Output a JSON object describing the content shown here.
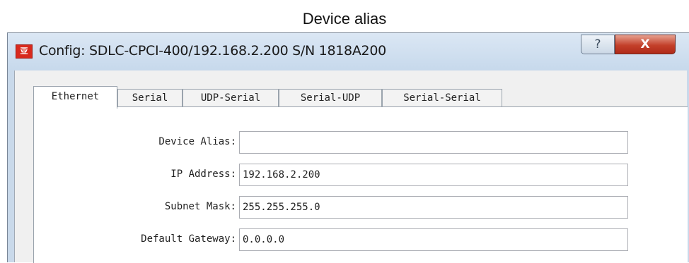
{
  "caption": "Device alias",
  "window": {
    "title": "Config: SDLC-CPCI-400/192.168.2.200 S/N 1818A200",
    "app_icon_glyph": "亚",
    "help_glyph": "?",
    "close_glyph": "X"
  },
  "tabs": [
    {
      "label": "Ethernet",
      "active": true
    },
    {
      "label": "Serial",
      "active": false
    },
    {
      "label": "UDP-Serial",
      "active": false
    },
    {
      "label": "Serial-UDP",
      "active": false
    },
    {
      "label": "Serial-Serial",
      "active": false
    }
  ],
  "fields": [
    {
      "label": "Device Alias:",
      "value": ""
    },
    {
      "label": "IP Address:",
      "value": "192.168.2.200"
    },
    {
      "label": "Subnet Mask:",
      "value": "255.255.255.0"
    },
    {
      "label": "Default Gateway:",
      "value": "0.0.0.0"
    }
  ],
  "colors": {
    "titlebar": "#c7d9ec",
    "close_button": "#c3402a",
    "client": "#f0f0f0"
  }
}
